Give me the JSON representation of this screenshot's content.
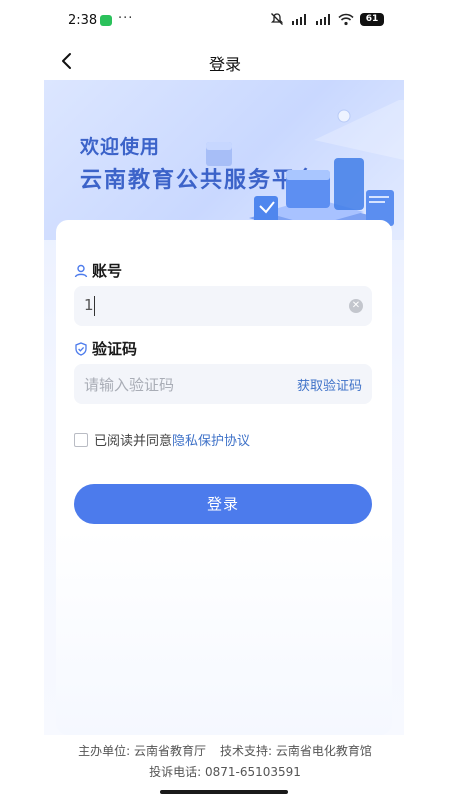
{
  "status_bar": {
    "time": "2:38",
    "more": "···",
    "battery": "61"
  },
  "nav": {
    "title": "登录"
  },
  "banner": {
    "line1": "欢迎使用",
    "line2": "云南教育公共服务平台"
  },
  "form": {
    "account_label": "账号",
    "account_value": "1",
    "code_label": "验证码",
    "code_placeholder": "请输入验证码",
    "get_code": "获取验证码",
    "agree_prefix": "已阅读并同意",
    "agree_link": "隐私保护协议",
    "login_button": "登录"
  },
  "footer": {
    "sponsor": "主办单位: 云南省教育厅",
    "support": "技术支持: 云南省电化教育馆",
    "complaint": "投诉电话: 0871-65103591"
  },
  "colors": {
    "primary": "#4c7bec",
    "link": "#3f72c8",
    "banner_text": "#3c63c9"
  }
}
